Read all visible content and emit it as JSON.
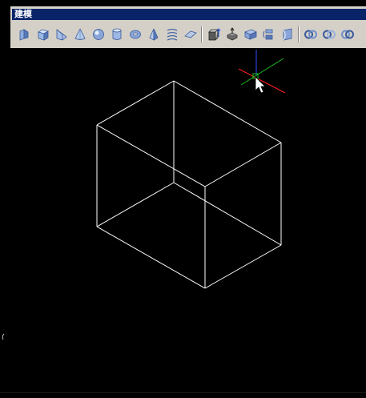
{
  "window": {
    "title": "建模"
  },
  "toolbar": {
    "buttons": [
      {
        "name": "polysolid-button",
        "icon": "polysolid-icon"
      },
      {
        "name": "box-button",
        "icon": "box-icon"
      },
      {
        "name": "wedge-button",
        "icon": "wedge-icon"
      },
      {
        "name": "cone-button",
        "icon": "cone-icon"
      },
      {
        "name": "sphere-button",
        "icon": "sphere-icon"
      },
      {
        "name": "cylinder-button",
        "icon": "cylinder-icon"
      },
      {
        "name": "torus-button",
        "icon": "torus-icon"
      },
      {
        "name": "pyramid-button",
        "icon": "pyramid-icon"
      },
      {
        "name": "helix-button",
        "icon": "helix-icon"
      },
      {
        "name": "planar-surface-button",
        "icon": "planar-surface-icon"
      },
      {
        "name": "extrude-button",
        "icon": "extrude-icon"
      },
      {
        "name": "presspull-button",
        "icon": "presspull-icon"
      },
      {
        "name": "sweep-button",
        "icon": "sweep-icon"
      },
      {
        "name": "revolve-button",
        "icon": "revolve-icon"
      },
      {
        "name": "loft-button",
        "icon": "loft-icon"
      },
      {
        "name": "union-button",
        "icon": "union-icon"
      },
      {
        "name": "subtract-button",
        "icon": "subtract-icon"
      },
      {
        "name": "intersect-button",
        "icon": "intersect-icon"
      }
    ]
  },
  "colors": {
    "background": "#000000",
    "titlebar": "#0a246a",
    "toolbar": "#d4d0c8",
    "wireframe": "#ffffff",
    "ucs_x": "#ff2020",
    "ucs_y": "#20c020",
    "ucs_z": "#3050ff"
  }
}
